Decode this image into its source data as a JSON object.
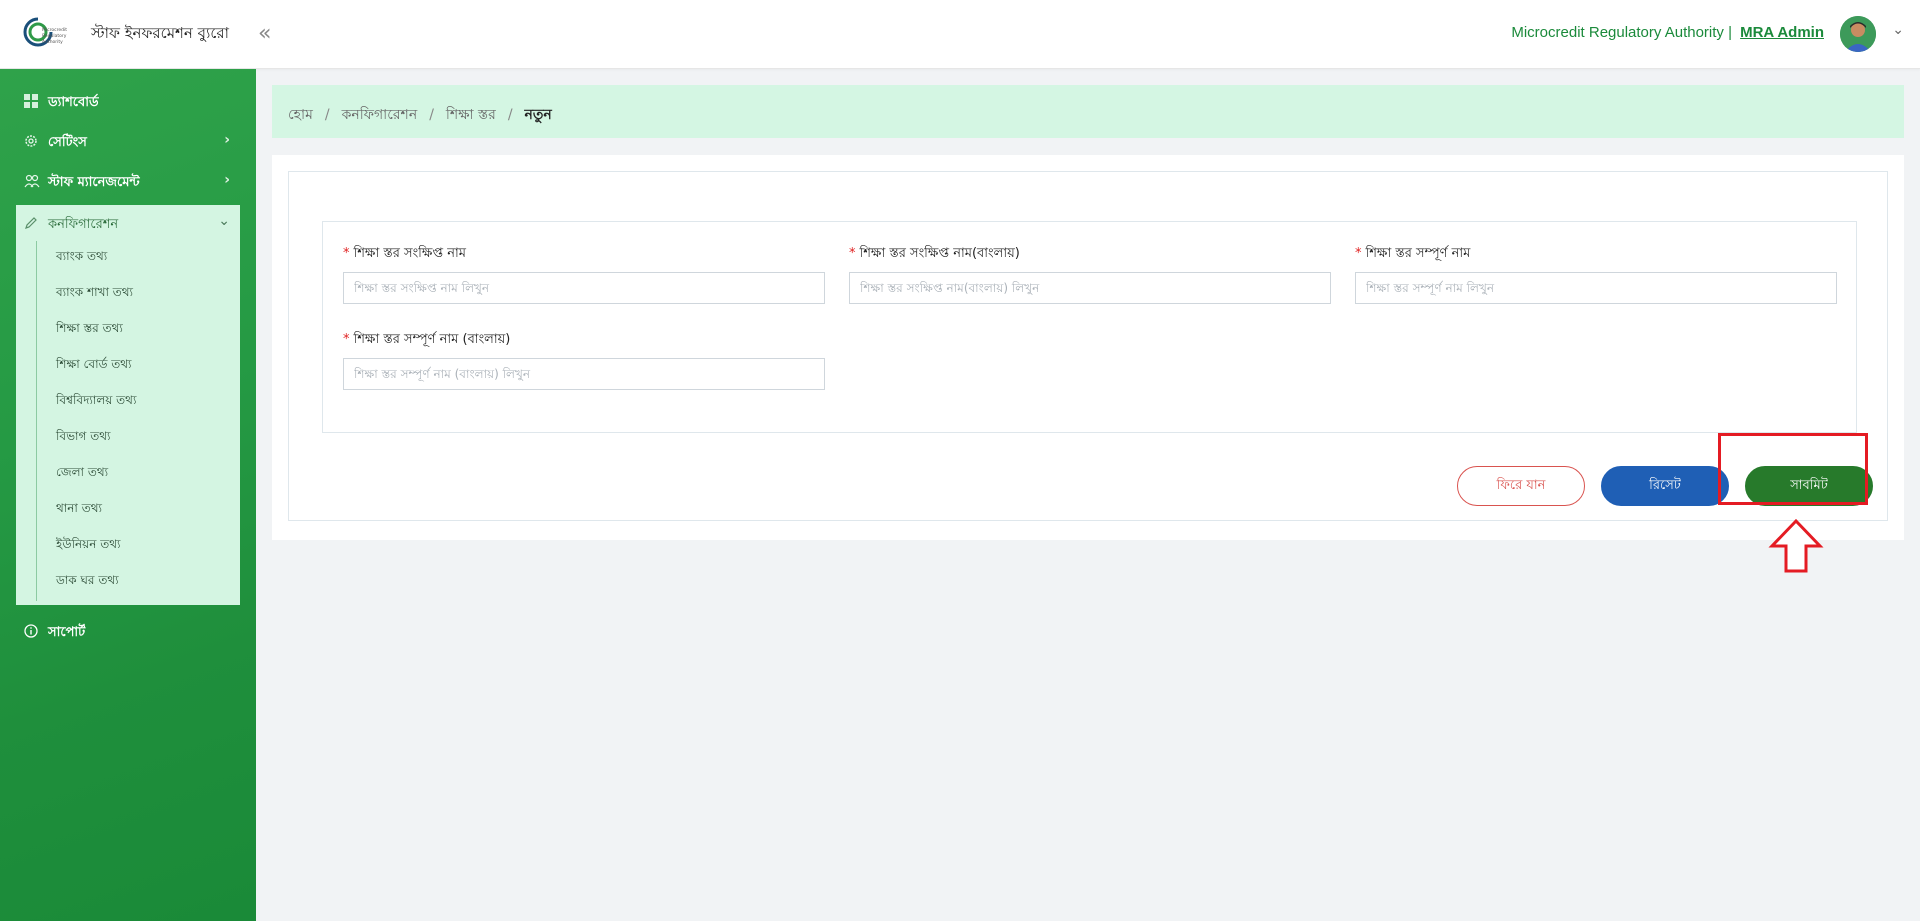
{
  "header": {
    "brand": "স্টাফ ইনফরমেশন ব্যুরো",
    "collapse_glyph": "«",
    "org_text": "Microcredit Regulatory Authority |",
    "user_name": "MRA Admin",
    "user_caret": "⌄",
    "logo_icon": "mra-logo-icon",
    "logo_lines": [
      "Microcredit",
      "Regulatory",
      "Authority"
    ]
  },
  "sidebar": {
    "items": [
      {
        "label": "ড্যাশবোর্ড",
        "icon": "grid-icon"
      },
      {
        "label": "সেটিংস",
        "icon": "gear-icon",
        "chevron": "›"
      },
      {
        "label": "স্টাফ ম্যানেজমেন্ট",
        "icon": "users-icon",
        "chevron": "›"
      }
    ],
    "open_group": {
      "label": "কনফিগারেশন",
      "icon": "pencil-icon",
      "chevron": "⌄",
      "sub_items": [
        "ব্যাংক তথ্য",
        "ব্যাংক শাখা তথ্য",
        "শিক্ষা স্তর তথ্য",
        "শিক্ষা বোর্ড তথ্য",
        "বিশ্ববিদ্যালয় তথ্য",
        "বিভাগ তথ্য",
        "জেলা তথ্য",
        "থানা তথ্য",
        "ইউনিয়ন তথ্য",
        "ডাক ঘর তথ্য"
      ]
    },
    "support": {
      "label": "সাপোর্ট",
      "icon": "info-icon"
    }
  },
  "breadcrumb": {
    "items": [
      "হোম",
      "কনফিগারেশন",
      "শিক্ষা স্তর"
    ],
    "current": "নতুন",
    "separator": "/"
  },
  "form": {
    "required_mark": "*",
    "fields": [
      {
        "label": "শিক্ষা স্তর সংক্ষিপ্ত নাম",
        "placeholder": "শিক্ষা স্তর সংক্ষিপ্ত নাম লিখুন",
        "value": ""
      },
      {
        "label": "শিক্ষা স্তর সংক্ষিপ্ত নাম(বাংলায়)",
        "placeholder": "শিক্ষা স্তর সংক্ষিপ্ত নাম(বাংলায়) লিখুন",
        "value": ""
      },
      {
        "label": "শিক্ষা স্তর সম্পূর্ণ নাম",
        "placeholder": "শিক্ষা স্তর সম্পূর্ণ নাম লিখুন",
        "value": ""
      },
      {
        "label": "শিক্ষা স্তর সম্পূর্ণ নাম (বাংলায়)",
        "placeholder": "শিক্ষা স্তর সম্পূর্ণ নাম (বাংলায়) লিখুন",
        "value": ""
      }
    ],
    "buttons": {
      "back": "ফিরে যান",
      "reset": "রিসেট",
      "submit": "সাবমিট"
    }
  },
  "colors": {
    "brand_green": "#1b8a3b",
    "sidebar_green": "#259a44",
    "submenu_bg": "#d4f5e2",
    "breadcrumb_bg": "#d4f6e3",
    "back_red": "#d9534f",
    "reset_blue": "#1f5fb5",
    "submit_green": "#277a2b",
    "annotation_red": "#e41b23"
  },
  "annotation": {
    "target": "submit-button",
    "shape": "rectangle",
    "pointer": "up-arrow"
  }
}
